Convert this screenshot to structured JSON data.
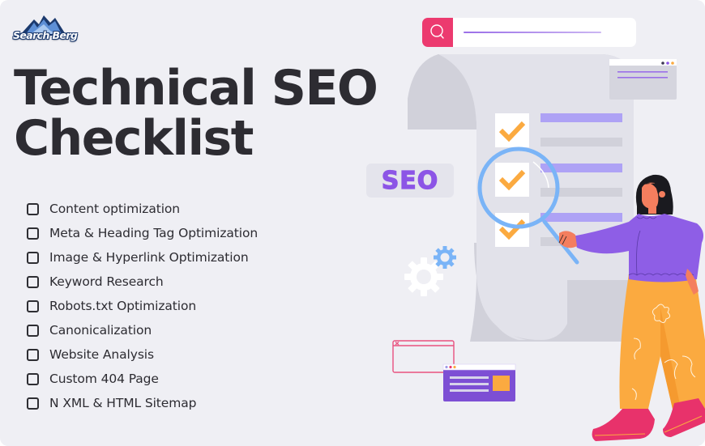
{
  "brand": {
    "logo_text": "Search Berg"
  },
  "title": {
    "line1": "Technical SEO",
    "line2": "Checklist"
  },
  "checklist": {
    "items": [
      {
        "label": "Content optimization",
        "checked": false
      },
      {
        "label": "Meta & Heading Tag Optimization",
        "checked": false
      },
      {
        "label": "Image & Hyperlink Optimization",
        "checked": false
      },
      {
        "label": "Keyword Research",
        "checked": false
      },
      {
        "label": "Robots.txt Optimization",
        "checked": false
      },
      {
        "label": "Canonicalization",
        "checked": false
      },
      {
        "label": "Website Analysis",
        "checked": false
      },
      {
        "label": "Custom 404 Page",
        "checked": false
      },
      {
        "label": "N XML & HTML Sitemap",
        "checked": false
      }
    ]
  },
  "illustration": {
    "seo_badge": "SEO",
    "search_icon": "magnifier-icon",
    "colors": {
      "background": "#efeff4",
      "title": "#2d2c32",
      "accent_pink": "#ec3a6f",
      "accent_purple": "#8c55e6",
      "accent_orange": "#fbaa40",
      "accent_blue": "#7ab4f7"
    }
  }
}
